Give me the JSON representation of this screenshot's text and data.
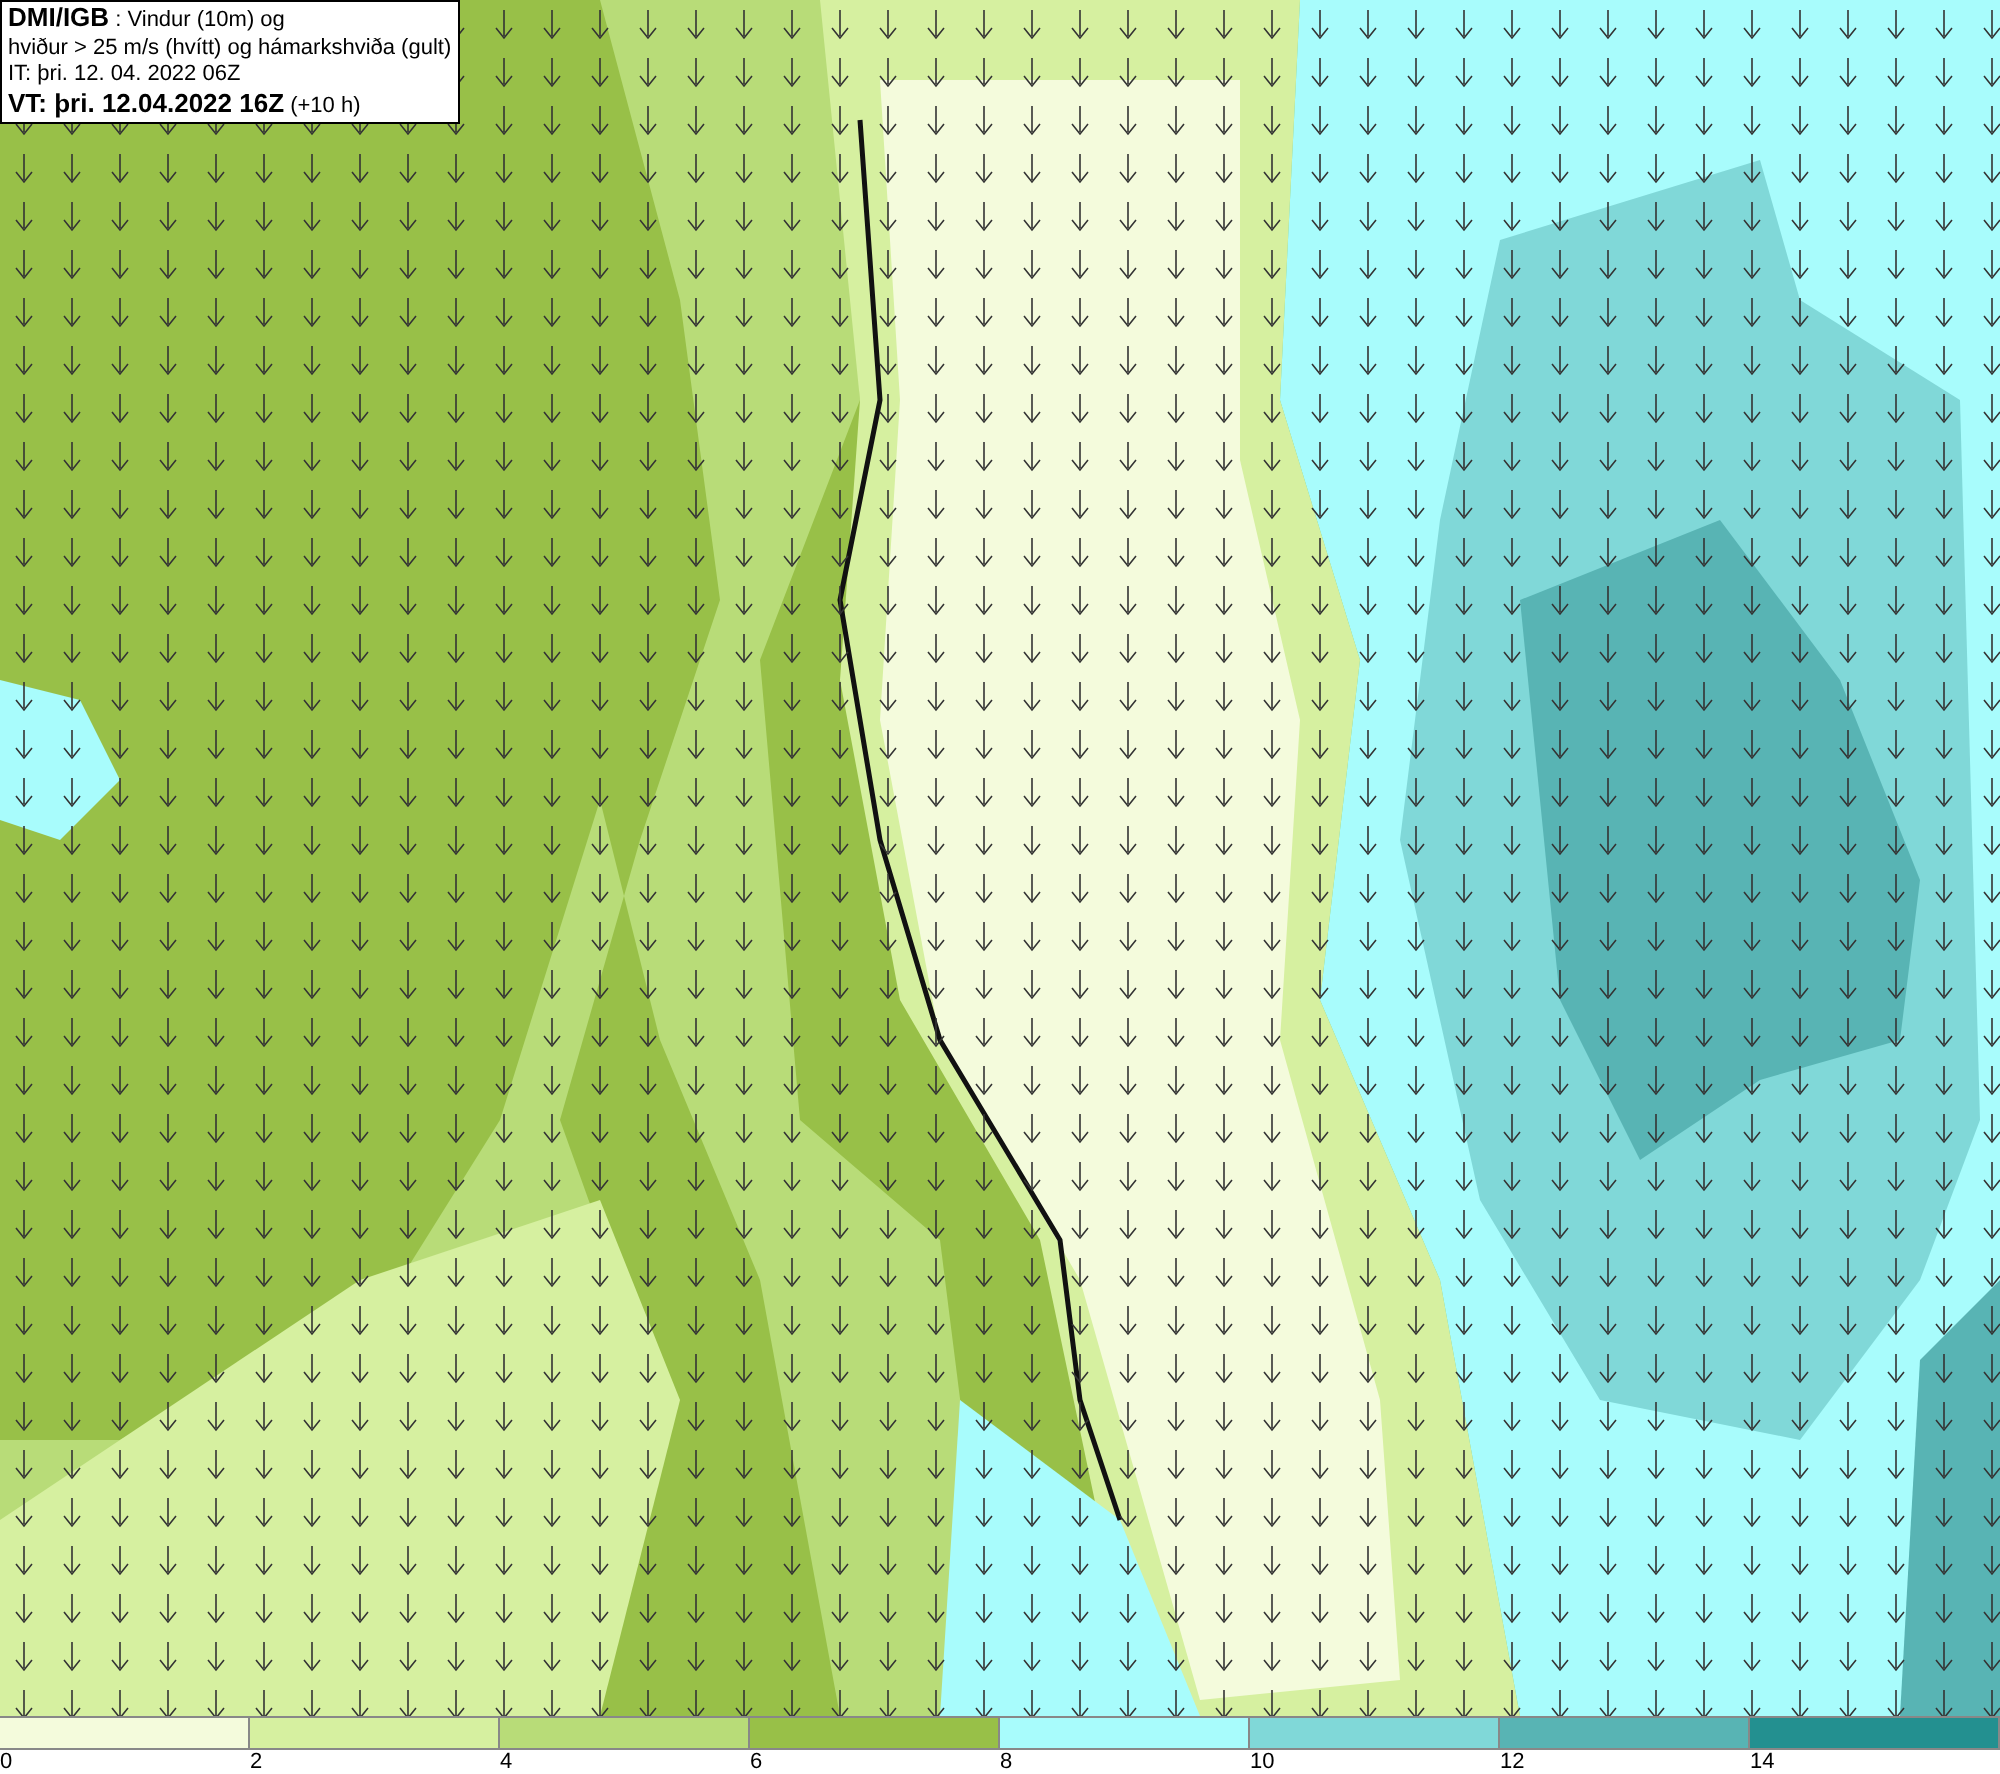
{
  "header": {
    "lines": [
      "**DMI/IGB** : Vindur (10m) og",
      "hviður > 25 m/s (hvítt) og hámarkshviða (gult)",
      "IT: þri. 12. 04. 2022 06Z",
      "**VT: þri. 12.04.2022 16Z** (+10 h)"
    ]
  },
  "legend": {
    "bins": [
      {
        "color": "#f4fbdc"
      },
      {
        "color": "#d6f0a0"
      },
      {
        "color": "#b8dc78"
      },
      {
        "color": "#98c048"
      },
      {
        "color": "#a8fcfc"
      },
      {
        "color": "#80d8d8"
      },
      {
        "color": "#58b4b4"
      },
      {
        "color": "#239090"
      }
    ],
    "ticks": [
      "0",
      "2",
      "4",
      "6",
      "8",
      "10",
      "12",
      "14"
    ]
  }
}
